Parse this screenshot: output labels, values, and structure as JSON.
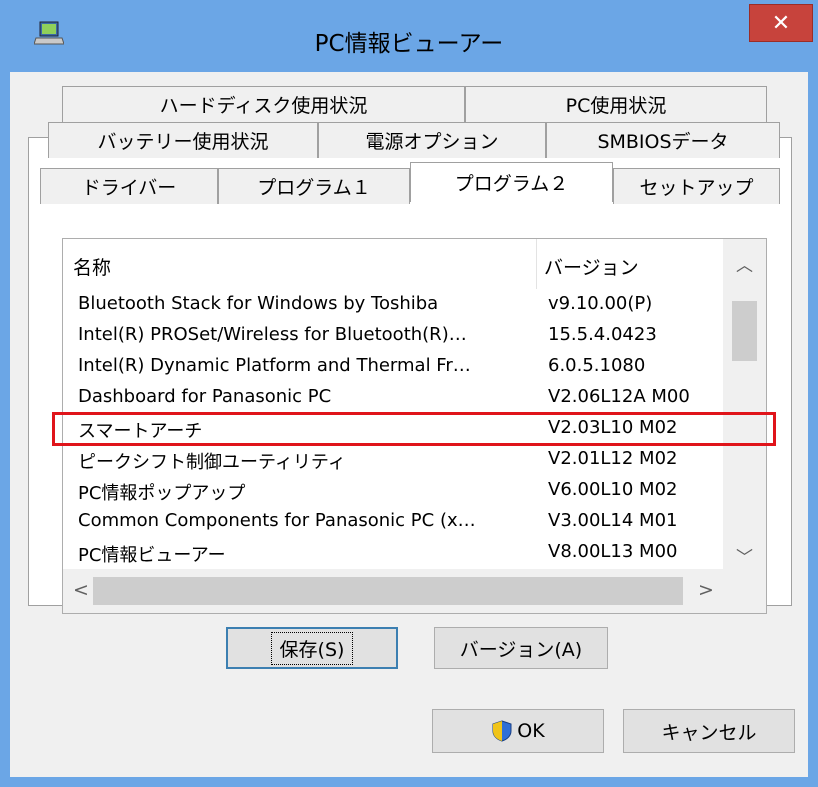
{
  "window": {
    "title": "PC情報ビューアー",
    "close_label": "✕"
  },
  "tabs": {
    "row1": [
      "ハードディスク使用状況",
      "PC使用状況"
    ],
    "row2": [
      "バッテリー使用状況",
      "電源オプション",
      "SMBIOSデータ"
    ],
    "row3": [
      "ドライバー",
      "プログラム１",
      "プログラム２",
      "セットアップ"
    ],
    "active": "プログラム２"
  },
  "list": {
    "columns": [
      "名称",
      "バージョン"
    ],
    "rows": [
      {
        "name": "Bluetooth Stack for Windows by Toshiba",
        "version": "v9.10.00(P)"
      },
      {
        "name": "Intel(R) PROSet/Wireless for Bluetooth(R)…",
        "version": "15.5.4.0423"
      },
      {
        "name": "Intel(R) Dynamic Platform and Thermal Fr…",
        "version": "6.0.5.1080"
      },
      {
        "name": "Dashboard for Panasonic PC",
        "version": "V2.06L12A M00"
      },
      {
        "name": "スマートアーチ",
        "version": "V2.03L10 M02"
      },
      {
        "name": "ピークシフト制御ユーティリティ",
        "version": "V2.01L12 M02"
      },
      {
        "name": "PC情報ポップアップ",
        "version": "V6.00L10 M02"
      },
      {
        "name": "Common Components for Panasonic PC (x…",
        "version": "V3.00L14 M01"
      },
      {
        "name": "PC情報ビューアー",
        "version": "V8.00L13 M00"
      }
    ],
    "highlighted_row": "スマートアーチ",
    "highlight_color": "#e0141a"
  },
  "buttons": {
    "save": "保存(S)",
    "version": "バージョン(A)",
    "ok": "OK",
    "cancel": "キャンセル"
  },
  "colors": {
    "titlebar": "#6ba6e6",
    "close": "#c7433c"
  }
}
